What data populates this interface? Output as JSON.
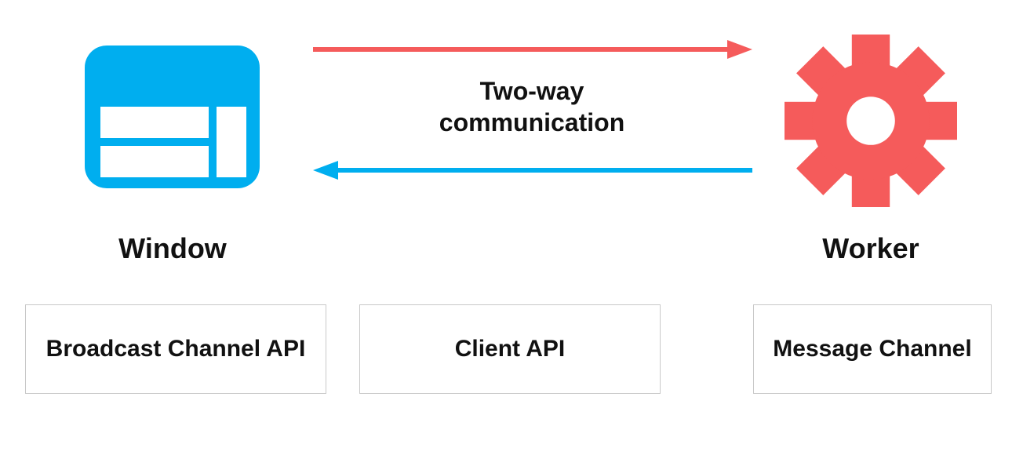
{
  "colors": {
    "window_icon": "#00aeef",
    "gear_icon": "#f55b5b",
    "arrow_to_worker": "#f55b5b",
    "arrow_to_window": "#00aeef",
    "box_border": "#c8c8c8",
    "text": "#111111"
  },
  "labels": {
    "center": "Two-way communication",
    "window": "Window",
    "worker": "Worker"
  },
  "api_boxes": [
    "Broadcast Channel API",
    "Client API",
    "Message Channel"
  ],
  "icons": {
    "left": "window-icon",
    "right": "gear-icon"
  }
}
